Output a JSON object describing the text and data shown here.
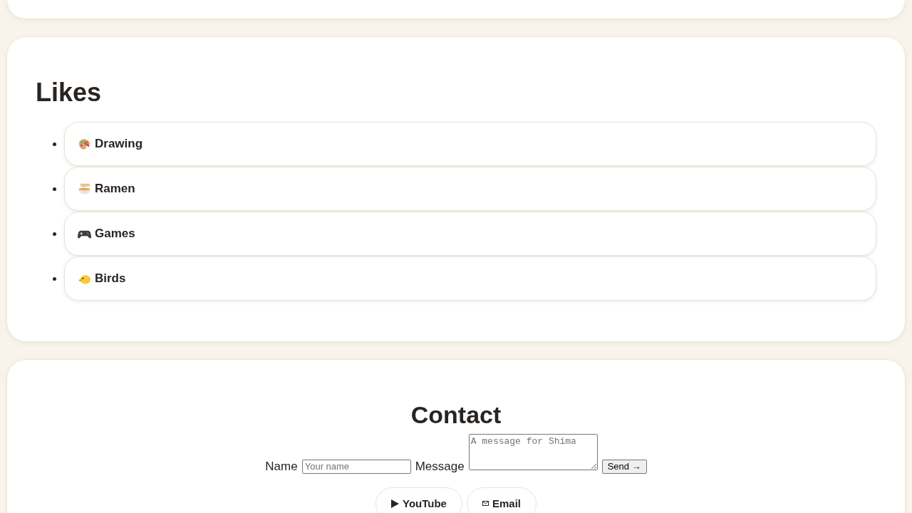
{
  "likes": {
    "heading": "Likes",
    "items": [
      {
        "label": "Drawing"
      },
      {
        "label": "Ramen"
      },
      {
        "label": "Games"
      },
      {
        "label": "Birds"
      }
    ]
  },
  "contact": {
    "heading": "Contact",
    "name_field": {
      "label": "Name",
      "placeholder": "Your name"
    },
    "message_field": {
      "label": "Message",
      "placeholder": "A message for Shima"
    },
    "send_button": "Send →",
    "links": [
      {
        "label": "YouTube"
      },
      {
        "label": "Email"
      }
    ]
  }
}
